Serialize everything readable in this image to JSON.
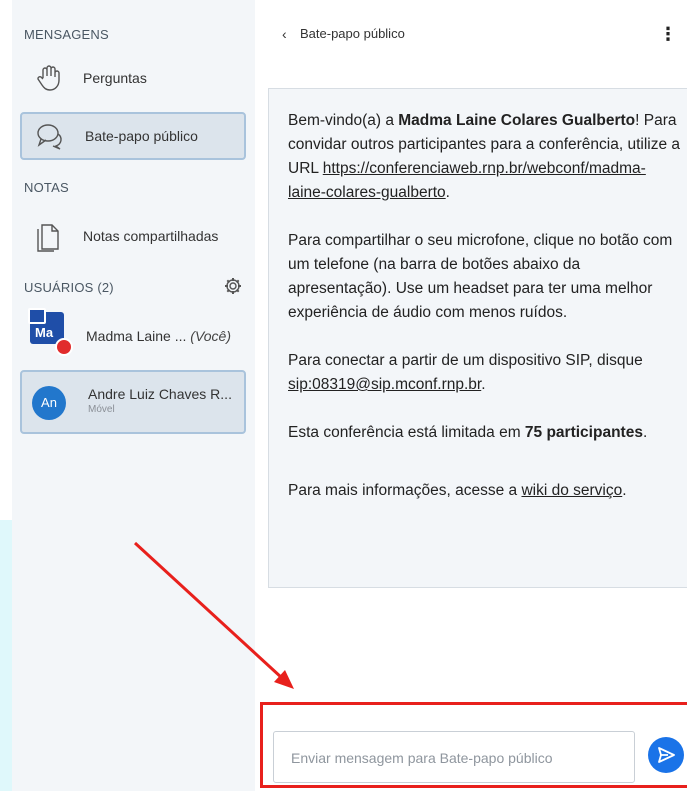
{
  "sidebar": {
    "messages_title": "MENSAGENS",
    "items": [
      {
        "label": "Perguntas",
        "icon": "hand-icon"
      },
      {
        "label": "Bate-papo público",
        "icon": "chat-bubbles-icon"
      }
    ],
    "notes_title": "NOTAS",
    "notes_item": {
      "label": "Notas compartilhadas",
      "icon": "document-icon"
    },
    "users_title": "USUÁRIOS (2)",
    "users": [
      {
        "initials": "Ma",
        "name": "Madma Laine ... ",
        "you": "(Você)",
        "sub": ""
      },
      {
        "initials": "An",
        "name": "Andre Luiz Chaves R...",
        "you": "",
        "sub": "Móvel"
      }
    ]
  },
  "chat": {
    "back_icon": "chevron-left-icon",
    "title": "Bate-papo público",
    "welcome": {
      "p1_a": "Bem-vindo(a) a ",
      "p1_bold": "Madma Laine Colares Gualberto",
      "p1_b": "! Para convidar outros participantes para a conferência, utilize a URL ",
      "p1_link": "https://conferenciaweb.rnp.br/webconf/madma-laine-colares-gualberto",
      "p1_c": ".",
      "p2": "Para compartilhar o seu microfone, clique no botão com um telefone (na barra de botões abaixo da apresentação). Use um headset para ter uma melhor experiência de áudio com menos ruídos.",
      "p3_a": "Para conectar a partir de um dispositivo SIP, disque ",
      "p3_link": "sip:08319@sip.mconf.rnp.br",
      "p3_b": ".",
      "p4_a": "Esta conferência está limitada em ",
      "p4_bold": "75 participantes",
      "p4_b": ".",
      "p5_a": "Para mais informações, acesse a ",
      "p5_link": "wiki do serviço",
      "p5_b": "."
    },
    "input_placeholder": "Enviar mensagem para Bate-papo público"
  },
  "colors": {
    "accent": "#1a73e8",
    "highlight_border": "#e8201c",
    "active_item": "#dce4ec"
  }
}
